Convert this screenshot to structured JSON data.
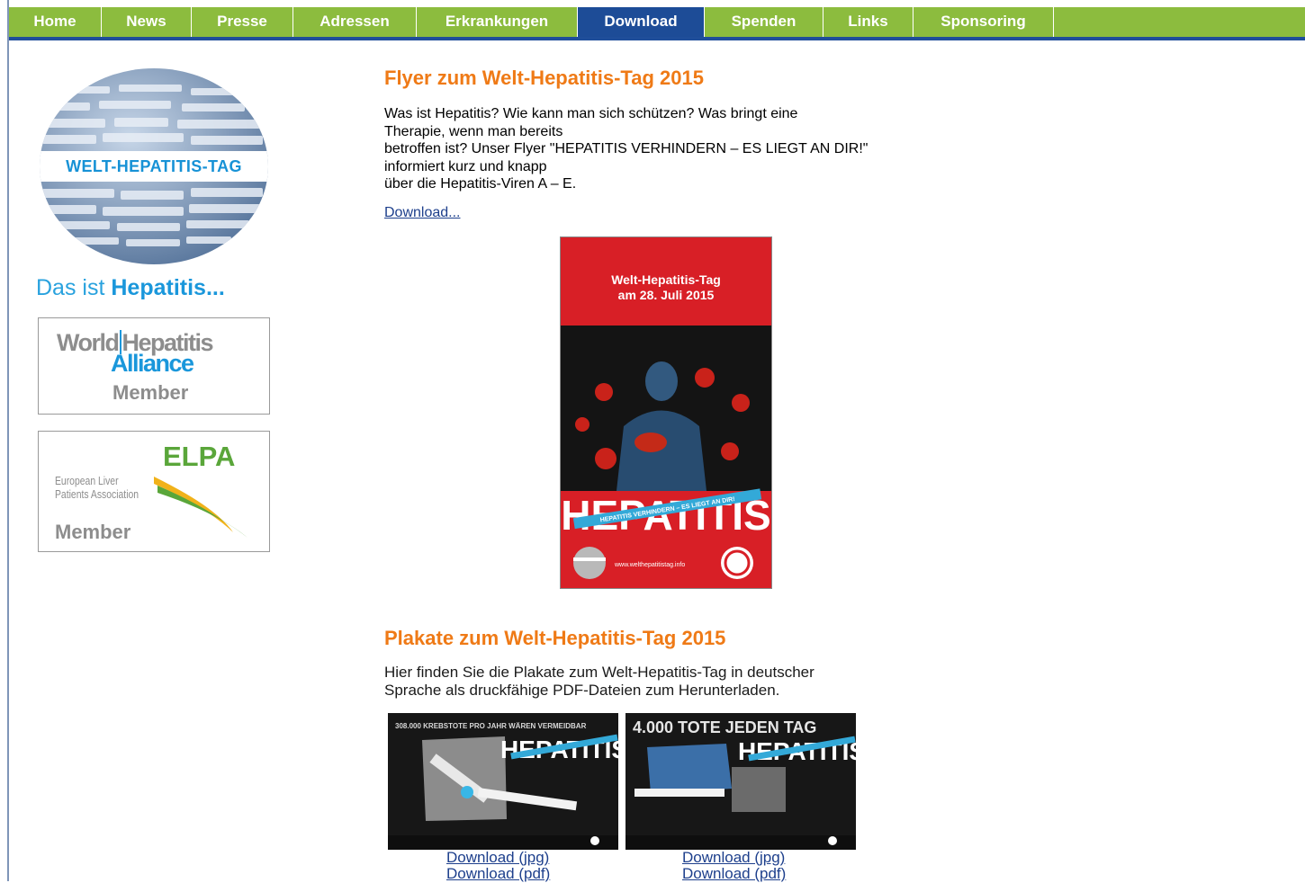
{
  "nav": {
    "items": [
      {
        "label": "Home"
      },
      {
        "label": "News"
      },
      {
        "label": "Presse"
      },
      {
        "label": "Adressen"
      },
      {
        "label": "Erkrankungen"
      },
      {
        "label": "Download"
      },
      {
        "label": "Spenden"
      },
      {
        "label": "Links"
      },
      {
        "label": "Sponsoring"
      }
    ],
    "active": "Download"
  },
  "sidebar": {
    "globe_text": "WELT-HEPATITIS-TAG",
    "das_ist_prefix": "Das ist",
    "das_ist_bold": "Hepatitis...",
    "whab": {
      "line1a": "World",
      "line1b": "Hepatitis",
      "line2": "Alliance",
      "member": "Member"
    },
    "elpa": {
      "acronym": "ELPA",
      "name1": "European Liver",
      "name2": "Patients Association",
      "member": "Member"
    }
  },
  "flyer": {
    "title": "Flyer zum Welt-Hepatitis-Tag 2015",
    "desc": [
      "Was ist Hepatitis? Wie kann man sich schützen? Was bringt eine",
      "Therapie, wenn man bereits",
      "betroffen ist? Unser Flyer \"HEPATITIS VERHINDERN – ES LIEGT AN DIR!\"",
      "informiert kurz und knapp",
      "über die Hepatitis-Viren A – E."
    ],
    "download_label": "Download...",
    "image": {
      "header1": "Welt-Hepatitis-Tag",
      "header2": "am 28. Juli 2015",
      "big_word": "HEPATITIS",
      "ribbon": "HEPATITIS VERHINDERN – ES LIEGT AN DIR!",
      "url": "www.welthepatitistag.info"
    }
  },
  "posters": {
    "title": "Plakate zum Welt-Hepatitis-Tag 2015",
    "desc": [
      "Hier finden Sie die Plakate zum Welt-Hepatitis-Tag in deutscher",
      "Sprache als druckfähige PDF-Dateien zum Herunterladen."
    ],
    "items": [
      {
        "headline": "308.000 KREBSTOTE PRO JAHR WÄREN VERMEIDBAR",
        "big_word": "HEPATITIS",
        "jpg": "Download (jpg)",
        "pdf": "Download (pdf)"
      },
      {
        "headline": "4.000 TOTE JEDEN TAG",
        "big_word": "HEPATITIS",
        "jpg": "Download (jpg)",
        "pdf": "Download (pdf)"
      }
    ]
  },
  "colors": {
    "nav_green": "#8cbc3e",
    "nav_active": "#1d4c97",
    "heading_orange": "#ef7a16",
    "link_blue": "#1d3f8c"
  }
}
